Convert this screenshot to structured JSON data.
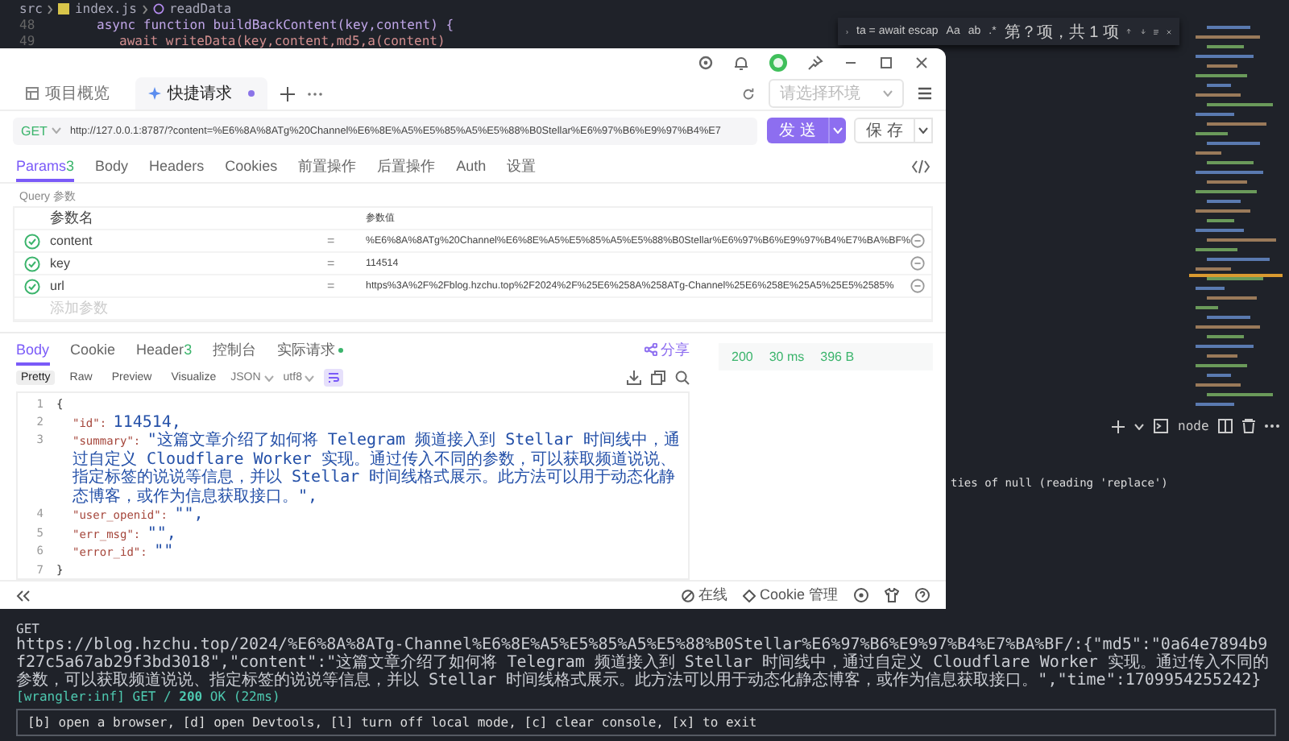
{
  "editor": {
    "breadcrumb": [
      "src",
      "index.js",
      "readData"
    ],
    "code_lines": [
      {
        "no": "48",
        "text": "async function buildBackContent(key,content) {"
      },
      {
        "no": "49",
        "text": "await writeData(key,content,md5,a(content)"
      }
    ]
  },
  "find_widget": {
    "query": "ta = await escap",
    "options": [
      "Aa",
      "ab",
      ".*"
    ],
    "result": "第？项，共 1 项"
  },
  "app": {
    "tabs": [
      {
        "label": "项目概览",
        "selected": false,
        "unsaved": false
      },
      {
        "label": "快捷请求",
        "selected": true,
        "unsaved": true
      }
    ],
    "environment": {
      "placeholder": "请选择环境"
    },
    "request": {
      "method": "GET",
      "url": "http://127.0.0.1:8787/?content=%E6%8A%8ATg%20Channel%E6%8E%A5%E5%85%A5%E5%88%B0Stellar%E6%97%B6%E9%97%B4%E7",
      "send": "发 送",
      "save": "保 存"
    },
    "request_tabs": [
      {
        "label": "Params",
        "count": "3",
        "selected": true
      },
      {
        "label": "Body",
        "selected": false
      },
      {
        "label": "Headers",
        "selected": false
      },
      {
        "label": "Cookies",
        "selected": false
      },
      {
        "label": "前置操作",
        "selected": false
      },
      {
        "label": "后置操作",
        "selected": false
      },
      {
        "label": "Auth",
        "selected": false
      },
      {
        "label": "设置",
        "selected": false
      }
    ],
    "query_label": "Query 参数",
    "params": {
      "columns": [
        "参数名",
        "参数值"
      ],
      "rows": [
        {
          "checked": true,
          "name": "content",
          "operator": "=",
          "value": "%E6%8A%8ATg%20Channel%E6%8E%A5%E5%85%A5%E5%88%B0Stellar%E6%97%B6%E9%97%B4%E7%BA%BF%"
        },
        {
          "checked": true,
          "name": "key",
          "operator": "=",
          "value": "114514"
        },
        {
          "checked": true,
          "name": "url",
          "operator": "=",
          "value": "https%3A%2F%2Fblog.hzchu.top%2F2024%2F%25E6%258A%258ATg-Channel%25E6%258E%25A5%25E5%2585%"
        }
      ],
      "add_placeholder": "添加参数"
    },
    "response_tabs": [
      {
        "label": "Body",
        "selected": true
      },
      {
        "label": "Cookie",
        "selected": false
      },
      {
        "label": "Header",
        "count": "3",
        "selected": false
      },
      {
        "label": "控制台",
        "selected": false
      },
      {
        "label": "实际请求",
        "selected": false
      }
    ],
    "share": "分享",
    "status": {
      "code": "200",
      "time": "30 ms",
      "size": "396 B"
    },
    "view_modes": [
      {
        "label": "Pretty",
        "selected": true
      },
      {
        "label": "Raw",
        "selected": false
      },
      {
        "label": "Preview",
        "selected": false
      },
      {
        "label": "Visualize",
        "selected": false
      }
    ],
    "format": "JSON",
    "encoding": "utf8",
    "body_lines": [
      {
        "no": "1",
        "kind": "brace",
        "value": "{"
      },
      {
        "no": "2",
        "kind": "pair",
        "key": "\"id\":",
        "value": "114514,"
      },
      {
        "no": "3",
        "kind": "pair",
        "key": "\"summary\":",
        "value": "\"这篇文章介绍了如何将 Telegram 频道接入到 Stellar 时间线中，通过自定义 Cloudflare Worker 实现。通过传入不同的参数，可以获取频道说说、指定标签的说说等信息，并以 Stellar 时间线格式展示。此方法可以用于动态化静态博客，或作为信息获取接口。\","
      },
      {
        "no": "4",
        "kind": "pair",
        "key": "\"user_openid\":",
        "value": "\"\","
      },
      {
        "no": "5",
        "kind": "pair",
        "key": "\"err_msg\":",
        "value": "\"\","
      },
      {
        "no": "6",
        "kind": "pair",
        "key": "\"error_id\":",
        "value": "\"\""
      },
      {
        "no": "7",
        "kind": "brace",
        "value": "}"
      }
    ],
    "footer": {
      "online": "在线",
      "cookie": "Cookie 管理"
    }
  },
  "terminal": {
    "shell": "node",
    "error_tail": "ties of null (reading 'replace')",
    "lines": [
      {
        "kind": "plain",
        "text": "GET"
      },
      {
        "kind": "plain",
        "text": "https://blog.hzchu.top/2024/%E6%8A%8ATg-Channel%E6%8E%A5%E5%85%A5%E5%88%B0Stellar%E6%97%B6%E9%97%B4%E7%BA%BF/:{\"md5\":\"0a64e7894b9f27c5a67ab29f3bd3018\",\"content\":\"这篇文章介绍了如何将 Telegram 频道接入到 Stellar 时间线中，通过自定义 Cloudflare Worker 实现。通过传入不同的参数，可以获取频道说说、指定标签的说说等信息，并以 Stellar 时间线格式展示。此方法可以用于动态化静态博客，或作为信息获取接口。\",\"time\":1709954255242}"
      },
      {
        "kind": "log",
        "text": "[wrangler:inf] GET / **200** OK (22ms)"
      }
    ],
    "hint": "[b] open a browser, [d] open Devtools, [l] turn off local mode, [c] clear console, [x] to exit"
  }
}
